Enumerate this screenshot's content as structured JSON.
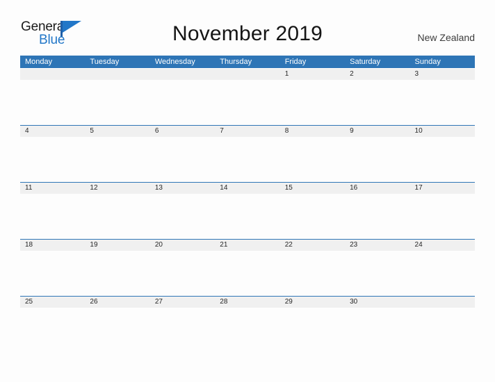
{
  "branding": {
    "name_top": "General",
    "name_bottom": "Blue",
    "mark": "triangle-flag-icon",
    "accent_color": "#2277c8"
  },
  "header": {
    "title": "November 2019",
    "locale": "New Zealand"
  },
  "theme": {
    "header_blue": "#2e75b6",
    "rule_blue": "#2e75b6",
    "date_band_gray": "#f0f0f0",
    "page_background": "#fdfdfd",
    "date_text": "#262626"
  },
  "calendar": {
    "weekdays": [
      "Monday",
      "Tuesday",
      "Wednesday",
      "Thursday",
      "Friday",
      "Saturday",
      "Sunday"
    ],
    "weeks": [
      {
        "days": [
          "",
          "",
          "",
          "",
          "1",
          "2",
          "3"
        ]
      },
      {
        "days": [
          "4",
          "5",
          "6",
          "7",
          "8",
          "9",
          "10"
        ]
      },
      {
        "days": [
          "11",
          "12",
          "13",
          "14",
          "15",
          "16",
          "17"
        ]
      },
      {
        "days": [
          "18",
          "19",
          "20",
          "21",
          "22",
          "23",
          "24"
        ]
      },
      {
        "days": [
          "25",
          "26",
          "27",
          "28",
          "29",
          "30",
          ""
        ]
      }
    ]
  }
}
